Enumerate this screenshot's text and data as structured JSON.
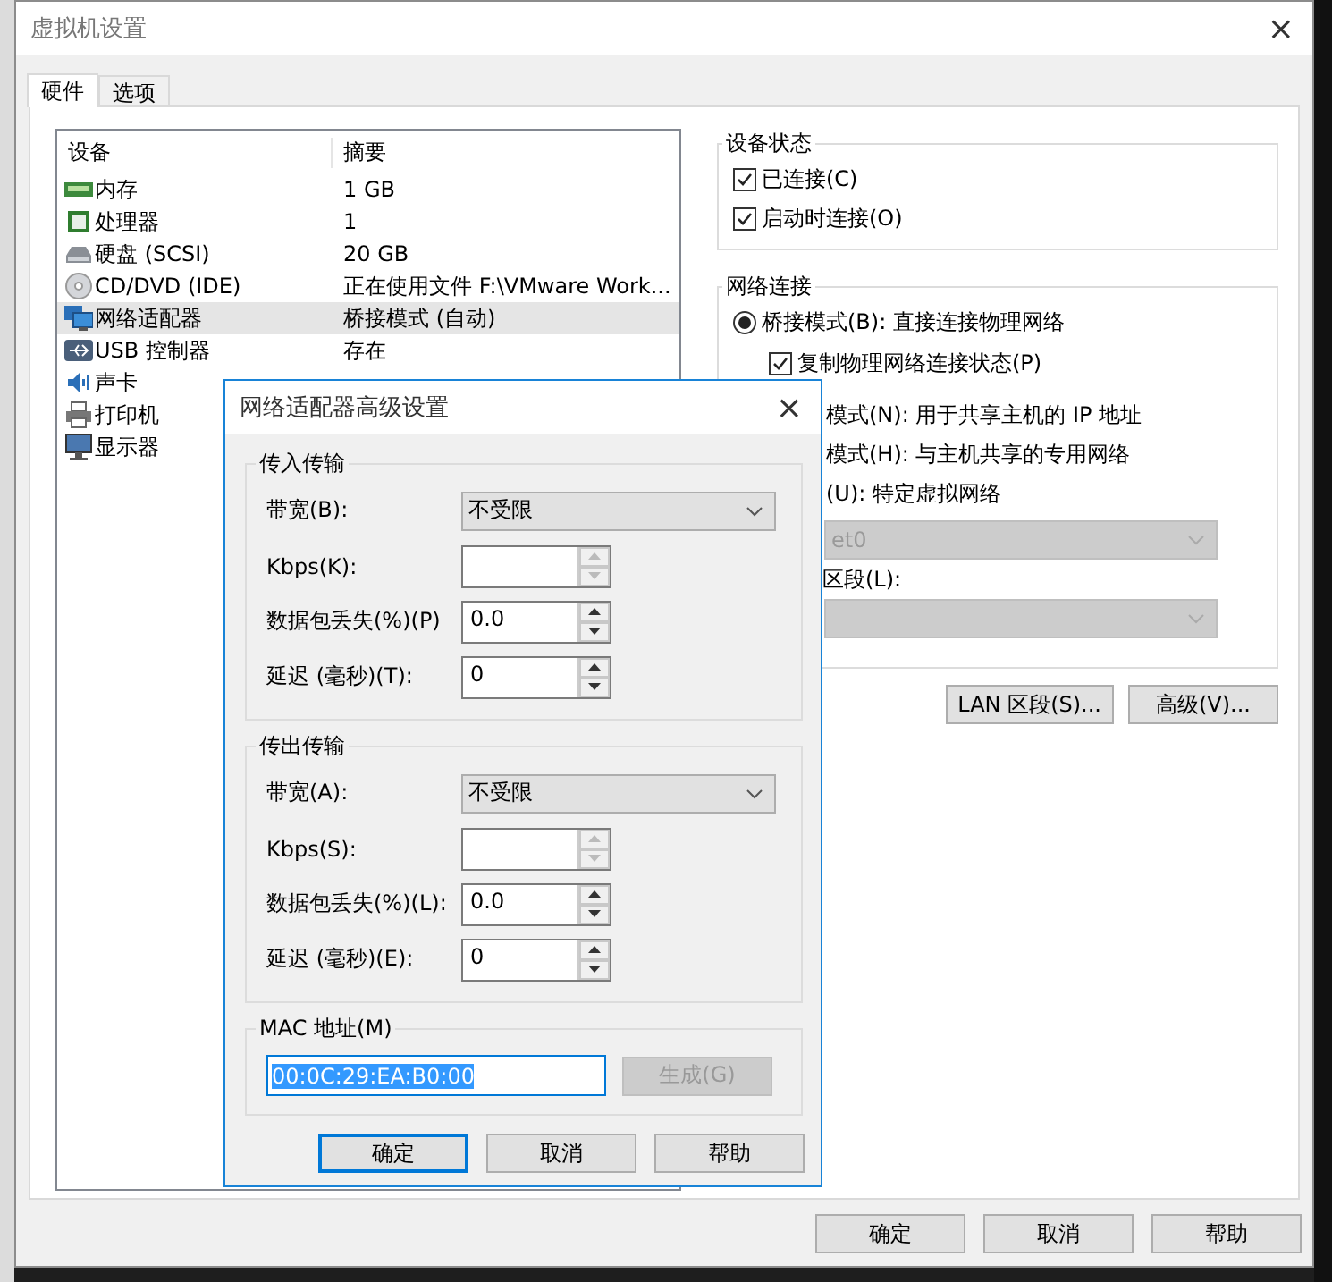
{
  "window": {
    "title": "虚拟机设置"
  },
  "tabs": [
    {
      "label": "硬件",
      "selected": true
    },
    {
      "label": "选项",
      "selected": false
    }
  ],
  "device_table": {
    "columns": [
      "设备",
      "摘要"
    ],
    "rows": [
      {
        "kind": "memory",
        "device": "内存",
        "summary": "1 GB",
        "selected": false
      },
      {
        "kind": "processor",
        "device": "处理器",
        "summary": "1",
        "selected": false
      },
      {
        "kind": "disk",
        "device": "硬盘 (SCSI)",
        "summary": "20 GB",
        "selected": false
      },
      {
        "kind": "cd",
        "device": "CD/DVD (IDE)",
        "summary": "正在使用文件 F:\\VMware Work...",
        "selected": false
      },
      {
        "kind": "network",
        "device": "网络适配器",
        "summary": "桥接模式 (自动)",
        "selected": true
      },
      {
        "kind": "usb",
        "device": "USB 控制器",
        "summary": "存在",
        "selected": false
      },
      {
        "kind": "sound",
        "device": "声卡",
        "selected": false
      },
      {
        "kind": "printer",
        "device": "打印机",
        "selected": false
      },
      {
        "kind": "display",
        "device": "显示器",
        "selected": false
      }
    ]
  },
  "device_status": {
    "title": "设备状态",
    "options": [
      {
        "label": "已连接(C)",
        "checked": true
      },
      {
        "label": "启动时连接(O)",
        "checked": true
      }
    ]
  },
  "network_connection": {
    "title": "网络连接",
    "bridged": {
      "label": "桥接模式(B): 直接连接物理网络",
      "selected": true
    },
    "replicate": {
      "label": "复制物理网络连接状态(P)",
      "checked": true
    },
    "partial_options": [
      "模式(N): 用于共享主机的 IP 地址",
      "模式(H): 与主机共享的专用网络",
      "(U): 特定虚拟网络"
    ],
    "custom_network": {
      "value": "et0",
      "disabled": true
    },
    "lan_segment_label": "区段(L):",
    "lan_segment": {
      "disabled": true
    }
  },
  "buttons": [
    "LAN 区段(S)...",
    "高级(V)..."
  ],
  "footer_buttons": [
    "确定",
    "取消",
    "帮助"
  ],
  "dialog": {
    "title": "网络适配器高级设置",
    "close": "×",
    "groups": [
      {
        "title": "传入传输",
        "fields": [
          {
            "kind": "dropdown",
            "label": "带宽(B):",
            "value": "不受限"
          },
          {
            "kind": "spinner",
            "label": "Kbps(K):",
            "disabled": true
          },
          {
            "kind": "spinner",
            "label": "数据包丢失(%)(P)",
            "value": "0.0",
            "disabled": false
          },
          {
            "kind": "spinner",
            "label": "延迟 (毫秒)(T):",
            "value": "0",
            "disabled": false
          }
        ]
      },
      {
        "title": "传出传输",
        "fields": [
          {
            "kind": "dropdown",
            "label": "带宽(A):",
            "value": "不受限"
          },
          {
            "kind": "spinner",
            "label": "Kbps(S):",
            "disabled": true
          },
          {
            "kind": "spinner",
            "label": "数据包丢失(%)(L):",
            "value": "0.0",
            "disabled": false
          },
          {
            "kind": "spinner",
            "label": "延迟 (毫秒)(E):",
            "value": "0",
            "disabled": false
          }
        ]
      }
    ],
    "mac": {
      "title": "MAC 地址(M)",
      "value": "00:0C:29:EA:B0:00",
      "value_selected": true,
      "generate": {
        "label": "生成(G)",
        "disabled": true
      }
    },
    "buttons": [
      {
        "label": "确定",
        "focused": true
      },
      {
        "label": "取消",
        "focused": false
      },
      {
        "label": "帮助",
        "focused": false
      }
    ]
  }
}
